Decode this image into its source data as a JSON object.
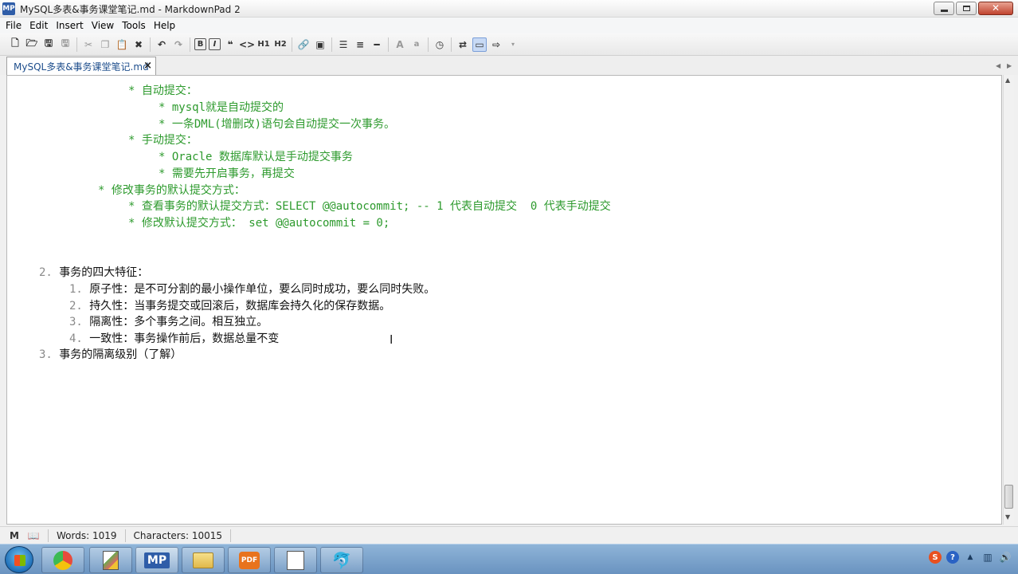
{
  "window": {
    "title": "MySQL多表&事务课堂笔记.md - MarkdownPad 2",
    "logo": "MP"
  },
  "menu": [
    "File",
    "Edit",
    "Insert",
    "View",
    "Tools",
    "Help"
  ],
  "toolbar": {
    "bold": "B",
    "italic": "I",
    "quote": "❝",
    "code": "<>",
    "h1": "H1",
    "h2": "H2",
    "font_large": "A",
    "font_small": "a"
  },
  "tab": {
    "label": "MySQL多表&事务课堂笔记.md",
    "close": "×"
  },
  "editor": {
    "lines": [
      "* 自动提交：",
      "* mysql就是自动提交的",
      "* 一条DML(增删改)语句会自动提交一次事务。",
      "* 手动提交：",
      "* Oracle 数据库默认是手动提交事务",
      "* 需要先开启事务，再提交",
      "* 修改事务的默认提交方式：",
      "* 查看事务的默认提交方式：SELECT @@autocommit; -- 1 代表自动提交  0 代表手动提交",
      "* 修改默认提交方式： set @@autocommit = 0;"
    ],
    "list": [
      {
        "num": "2.",
        "text": "事务的四大特征："
      },
      {
        "num": "1.",
        "text": "原子性：是不可分割的最小操作单位，要么同时成功，要么同时失败。"
      },
      {
        "num": "2.",
        "text": "持久性：当事务提交或回滚后，数据库会持久化的保存数据。"
      },
      {
        "num": "3.",
        "text": "隔离性：多个事务之间。相互独立。"
      },
      {
        "num": "4.",
        "text": "一致性：事务操作前后，数据总量不变"
      },
      {
        "num": "3.",
        "text": "事务的隔离级别（了解）"
      }
    ]
  },
  "status": {
    "words": "Words: 1019",
    "characters": "Characters: 10015"
  },
  "taskbar": {
    "markdownpad": "MP",
    "pdf": "PDF"
  },
  "tray": {
    "sogou": "S",
    "help": "?"
  },
  "colors": {
    "list_text_green": "#2d9a2d",
    "tab_text": "#1e4e8c",
    "taskbar": "#6a93c0"
  }
}
